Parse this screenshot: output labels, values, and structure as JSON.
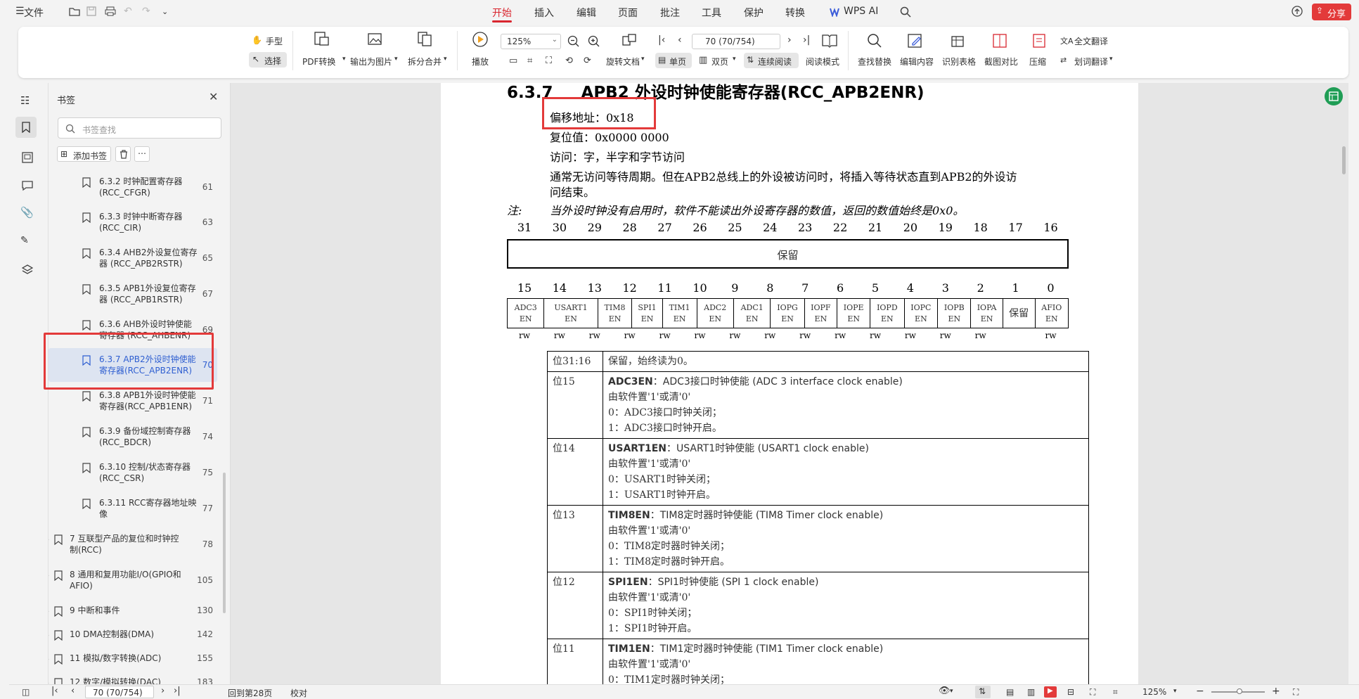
{
  "menu": {
    "file": "文件",
    "tabs": [
      "开始",
      "插入",
      "编辑",
      "页面",
      "批注",
      "工具",
      "保护",
      "转换"
    ],
    "wps_ai": "WPS AI",
    "share": "分享"
  },
  "toolbar": {
    "hand": "手型",
    "select": "选择",
    "pdf_convert": "PDF转换",
    "export_image": "输出为图片",
    "split_merge": "拆分合并",
    "play": "播放",
    "zoom": "125%",
    "page_input": "70 (70/754)",
    "rotate": "旋转文档",
    "single": "单页",
    "double": "双页",
    "continuous": "连续阅读",
    "reading_mode": "阅读模式",
    "find_replace": "查找替换",
    "edit_content": "编辑内容",
    "recognize_table": "识别表格",
    "screenshot_compare": "截图对比",
    "compress": "压缩",
    "full_translate": "全文翻译",
    "word_translate": "划词翻译"
  },
  "bookmarks": {
    "title": "书签",
    "search_placeholder": "书签查找",
    "add": "添加书签",
    "items": [
      {
        "label": "6.3.2 时钟配置寄存器(RCC_CFGR)",
        "page": "61"
      },
      {
        "label": "6.3.3 时钟中断寄存器(RCC_CIR)",
        "page": "63"
      },
      {
        "label": "6.3.4 AHB2外设复位寄存器 (RCC_APB2RSTR)",
        "page": "65"
      },
      {
        "label": "6.3.5 APB1外设复位寄存器 (RCC_APB1RSTR)",
        "page": "67"
      },
      {
        "label": "6.3.6 AHB外设时钟使能寄存器 (RCC_AHBENR)",
        "page": "69"
      },
      {
        "label": "6.3.7 APB2外设时钟使能寄存器(RCC_APB2ENR)",
        "page": "70"
      },
      {
        "label": "6.3.8 APB1外设时钟使能寄存器(RCC_APB1ENR)",
        "page": "71"
      },
      {
        "label": "6.3.9 备份域控制寄存器 (RCC_BDCR)",
        "page": "74"
      },
      {
        "label": "6.3.10 控制/状态寄存器 (RCC_CSR)",
        "page": "75"
      },
      {
        "label": "6.3.11 RCC寄存器地址映像",
        "page": "77"
      }
    ],
    "sections": [
      {
        "label": "7 互联型产品的复位和时钟控制(RCC)",
        "page": "78"
      },
      {
        "label": "8 通用和复用功能I/O(GPIO和AFIO)",
        "page": "105"
      },
      {
        "label": "9 中断和事件",
        "page": "130"
      },
      {
        "label": "10 DMA控制器(DMA)",
        "page": "142"
      },
      {
        "label": "11 模拟/数字转换(ADC)",
        "page": "155"
      },
      {
        "label": "12 数字/模拟转换(DAC)",
        "page": "183"
      }
    ]
  },
  "doc": {
    "heading_num": "6.3.7",
    "heading": "APB2 外设时钟使能寄存器(RCC_APB2ENR)",
    "offset": "偏移地址：0x18",
    "reset": "复位值：0x0000 0000",
    "access": "访问：字，半字和字节访问",
    "wait1": "通常无访问等待周期。但在APB2总线上的外设被访问时，将插入等待状态直到APB2的外设访",
    "wait2": "问结束。",
    "note_label": "注:",
    "note": "当外设时钟没有启用时，软件不能读出外设寄存器的数值，返回的数值始终是0x0。",
    "bits_high": [
      "31",
      "30",
      "29",
      "28",
      "27",
      "26",
      "25",
      "24",
      "23",
      "22",
      "21",
      "20",
      "19",
      "18",
      "17",
      "16"
    ],
    "reserved": "保留",
    "bits_low": [
      "15",
      "14",
      "13",
      "12",
      "11",
      "10",
      "9",
      "8",
      "7",
      "6",
      "5",
      "4",
      "3",
      "2",
      "1",
      "0"
    ],
    "fields": [
      [
        "ADC3",
        "EN"
      ],
      [
        "USART1",
        "EN"
      ],
      [
        "TIM8",
        "EN"
      ],
      [
        "SPI1",
        "EN"
      ],
      [
        "TIM1",
        "EN"
      ],
      [
        "ADC2",
        "EN"
      ],
      [
        "ADC1",
        "EN"
      ],
      [
        "IOPG",
        "EN"
      ],
      [
        "IOPF",
        "EN"
      ],
      [
        "IOPE",
        "EN"
      ],
      [
        "IOPD",
        "EN"
      ],
      [
        "IOPC",
        "EN"
      ],
      [
        "IOPB",
        "EN"
      ],
      [
        "IOPA",
        "EN"
      ],
      [
        "保留",
        ""
      ],
      [
        "AFIO",
        "EN"
      ]
    ],
    "rw": [
      "rw",
      "rw",
      "rw",
      "rw",
      "rw",
      "rw",
      "rw",
      "rw",
      "rw",
      "rw",
      "rw",
      "rw",
      "rw",
      "rw",
      "",
      "rw"
    ],
    "rows": [
      {
        "bit": "位31:16",
        "lines": [
          "保留，始终读为0。"
        ]
      },
      {
        "bit": "位15",
        "title": "ADC3EN",
        "title_rest": "：ADC3接口时钟使能 (ADC 3 interface clock enable)",
        "lines": [
          "由软件置'1'或清'0'",
          "0：ADC3接口时钟关闭；",
          "1：ADC3接口时钟开启。"
        ]
      },
      {
        "bit": "位14",
        "title": "USART1EN",
        "title_rest": "：USART1时钟使能 (USART1 clock enable)",
        "lines": [
          "由软件置'1'或清'0'",
          "0：USART1时钟关闭；",
          "1：USART1时钟开启。"
        ]
      },
      {
        "bit": "位13",
        "title": "TIM8EN",
        "title_rest": "：TIM8定时器时钟使能 (TIM8 Timer clock enable)",
        "lines": [
          "由软件置'1'或清'0'",
          "0：TIM8定时器时钟关闭；",
          "1：TIM8定时器时钟开启。"
        ]
      },
      {
        "bit": "位12",
        "title": "SPI1EN",
        "title_rest": "：SPI1时钟使能 (SPI 1 clock enable)",
        "lines": [
          "由软件置'1'或清'0'",
          "0：SPI1时钟关闭；",
          "1：SPI1时钟开启。"
        ]
      },
      {
        "bit": "位11",
        "title": "TIM1EN",
        "title_rest": "：TIM1定时器时钟使能 (TIM1 Timer clock enable)",
        "lines": [
          "由软件置'1'或清'0'",
          "0：TIM1定时器时钟关闭；"
        ]
      }
    ]
  },
  "status": {
    "page_input": "70 (70/754)",
    "back": "回到第28页",
    "proof": "校对",
    "zoom": "125%"
  }
}
